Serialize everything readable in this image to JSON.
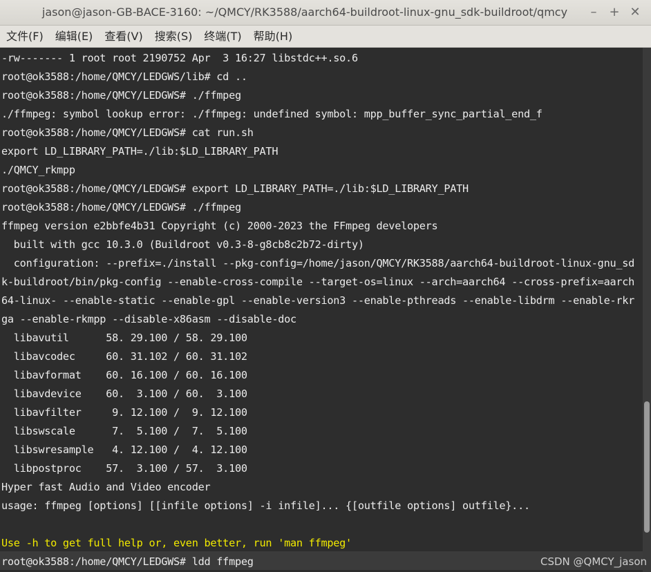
{
  "window": {
    "title": "jason@jason-GB-BACE-3160: ~/QMCY/RK3588/aarch64-buildroot-linux-gnu_sdk-buildroot/qmcy",
    "minimize_glyph": "–",
    "maximize_glyph": "+",
    "close_glyph": "✕"
  },
  "menubar": {
    "items": [
      {
        "label": "文件(F)"
      },
      {
        "label": "编辑(E)"
      },
      {
        "label": "查看(V)"
      },
      {
        "label": "搜索(S)"
      },
      {
        "label": "终端(T)"
      },
      {
        "label": "帮助(H)"
      }
    ]
  },
  "terminal": {
    "lines": [
      "-rw------- 1 root root 2190752 Apr  3 16:27 libstdc++.so.6",
      "root@ok3588:/home/QMCY/LEDGWS/lib# cd ..",
      "root@ok3588:/home/QMCY/LEDGWS# ./ffmpeg",
      "./ffmpeg: symbol lookup error: ./ffmpeg: undefined symbol: mpp_buffer_sync_partial_end_f",
      "root@ok3588:/home/QMCY/LEDGWS# cat run.sh",
      "export LD_LIBRARY_PATH=./lib:$LD_LIBRARY_PATH",
      "./QMCY_rkmpp",
      "root@ok3588:/home/QMCY/LEDGWS# export LD_LIBRARY_PATH=./lib:$LD_LIBRARY_PATH",
      "root@ok3588:/home/QMCY/LEDGWS# ./ffmpeg",
      "ffmpeg version e2bbfe4b31 Copyright (c) 2000-2023 the FFmpeg developers",
      "  built with gcc 10.3.0 (Buildroot v0.3-8-g8cb8c2b72-dirty)",
      "  configuration: --prefix=./install --pkg-config=/home/jason/QMCY/RK3588/aarch64-buildroot-linux-gnu_sd",
      "k-buildroot/bin/pkg-config --enable-cross-compile --target-os=linux --arch=aarch64 --cross-prefix=aarch",
      "64-linux- --enable-static --enable-gpl --enable-version3 --enable-pthreads --enable-libdrm --enable-rkr",
      "ga --enable-rkmpp --disable-x86asm --disable-doc",
      "  libavutil      58. 29.100 / 58. 29.100",
      "  libavcodec     60. 31.102 / 60. 31.102",
      "  libavformat    60. 16.100 / 60. 16.100",
      "  libavdevice    60.  3.100 / 60.  3.100",
      "  libavfilter     9. 12.100 /  9. 12.100",
      "  libswscale      7.  5.100 /  7.  5.100",
      "  libswresample   4. 12.100 /  4. 12.100",
      "  libpostproc    57.  3.100 / 57.  3.100",
      "Hyper fast Audio and Video encoder",
      "usage: ffmpeg [options] [[infile options] -i infile]... {[outfile options] outfile}...",
      "",
      "Use -h to get full help or, even better, run 'man ffmpeg'",
      "root@ok3588:/home/QMCY/LEDGWS# ldd ffmpeg"
    ],
    "hint_line_index": 26,
    "current_line_index": 27
  },
  "scrollbar": {
    "position_fraction": 0.9,
    "visible_fraction": 0.25
  },
  "watermark": "CSDN @QMCY_jason",
  "colors": {
    "terminal_bg": "#2d2d2d",
    "terminal_fg": "#ebebeb",
    "hint_fg": "#f2ea00"
  }
}
